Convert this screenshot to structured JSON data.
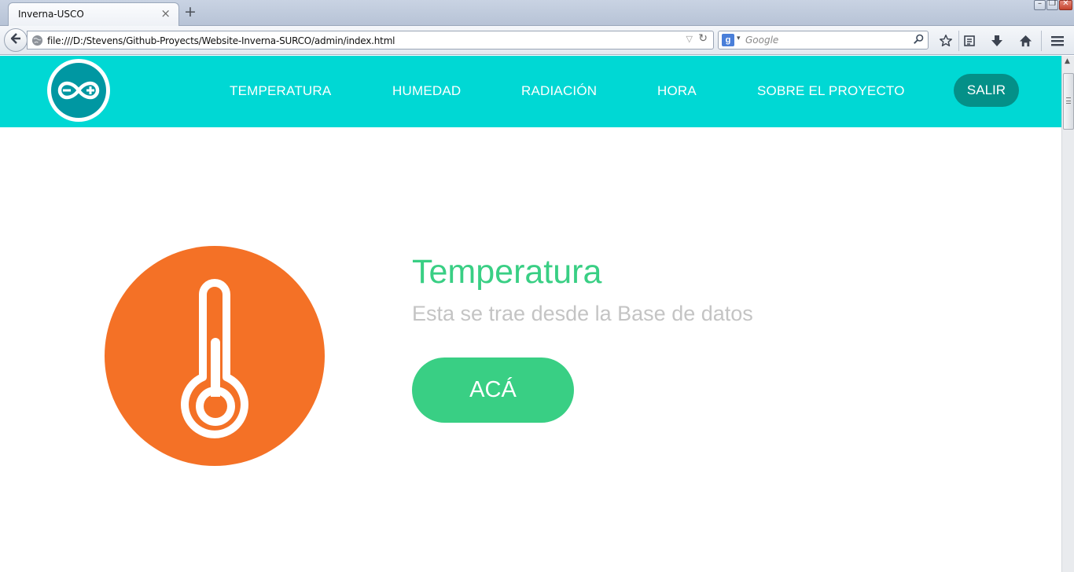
{
  "browser": {
    "tab_title": "Inverna-USCO",
    "tab_close_glyph": "×",
    "new_tab_glyph": "+",
    "url": "file:///D:/Stevens/Github-Proyects/Website-Inverna-SURCO/admin/index.html",
    "search_engine": "Google",
    "search_placeholder": "Google",
    "window_controls": {
      "minimize_glyph": "–",
      "restore_glyph": "❐",
      "close_glyph": "✕"
    },
    "icons": [
      "back-arrow-icon",
      "globe-icon",
      "dropdown-icon",
      "reload-icon",
      "google-icon",
      "search-icon",
      "bookmark-star-icon",
      "reading-list-icon",
      "download-icon",
      "home-icon",
      "menu-icon"
    ]
  },
  "site": {
    "logo_icon": "arduino-infinity-icon",
    "nav": {
      "temperatura": "TEMPERATURA",
      "humedad": "HUMEDAD",
      "radiacion": "RADIACIÓN",
      "hora": "HORA",
      "sobre": "SOBRE EL PROYECTO"
    },
    "logout_label": "SALIR",
    "colors": {
      "header_bg": "#00d8d4",
      "logout_bg": "#049088",
      "accent_green": "#39cf84",
      "icon_orange": "#f47126",
      "subtitle_gray": "#c4c4c4"
    }
  },
  "main": {
    "icon": "thermometer-icon",
    "title": "Temperatura",
    "subtitle": "Esta se trae desde la Base de datos",
    "cta_label": "ACÁ"
  }
}
